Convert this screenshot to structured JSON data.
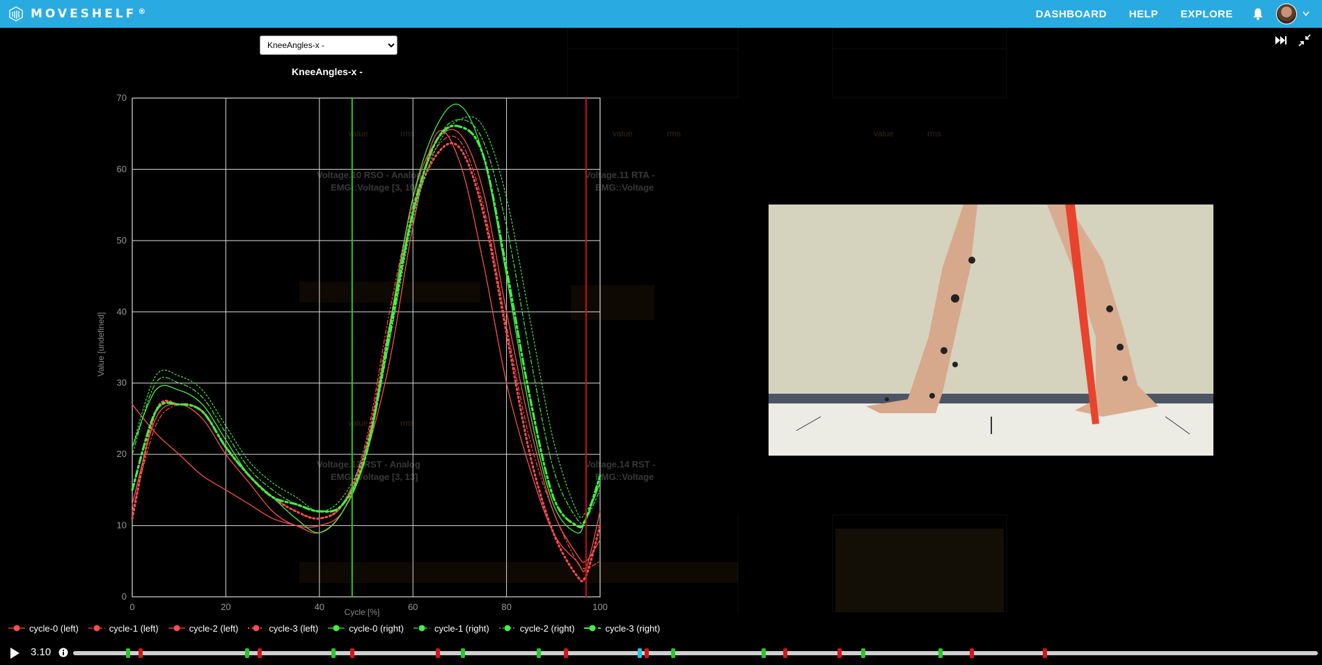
{
  "brand": {
    "name": "MOVESHELF",
    "reg": "®"
  },
  "nav": {
    "dashboard": "DASHBOARD",
    "help": "HELP",
    "explore": "EXPLORE"
  },
  "colors": {
    "topbar": "#29abe2",
    "left": "#ff4d4d",
    "right": "#44ee44",
    "vline_right": "#22cc22",
    "vline_left": "#cc1111",
    "event_cyan": "#22c4e6"
  },
  "plot": {
    "selected": "KneeAngles-x -",
    "options": [
      "KneeAngles-x -"
    ],
    "title": "KneeAngles-x -"
  },
  "chart_data": {
    "type": "line",
    "title": "KneeAngles-x -",
    "xlabel": "Cycle [%]",
    "ylabel": "Value [undefined]",
    "xlim": [
      0,
      100
    ],
    "ylim": [
      0,
      70
    ],
    "xticks": [
      0,
      20,
      40,
      60,
      80,
      100
    ],
    "yticks": [
      0,
      10,
      20,
      30,
      40,
      50,
      60,
      70
    ],
    "grid": true,
    "vlines": [
      {
        "x": 47,
        "color": "#22cc22"
      },
      {
        "x": 97,
        "color": "#cc1111"
      }
    ],
    "series": [
      {
        "name": "cycle-0 (left)",
        "side": "left",
        "style": "thin",
        "x": [
          0,
          5,
          10,
          15,
          20,
          25,
          30,
          35,
          40,
          45,
          50,
          55,
          60,
          65,
          70,
          75,
          80,
          85,
          90,
          95,
          97,
          100
        ],
        "values": [
          27,
          23,
          20,
          17,
          15,
          13,
          11,
          10,
          9,
          12,
          20,
          33,
          52,
          65,
          61,
          47,
          30,
          18,
          9,
          5,
          4,
          12
        ]
      },
      {
        "name": "cycle-1 (left)",
        "side": "left",
        "style": "dashdot-thin",
        "x": [
          0,
          5,
          10,
          15,
          20,
          25,
          30,
          35,
          40,
          45,
          50,
          55,
          60,
          65,
          70,
          75,
          80,
          85,
          90,
          95,
          97,
          100
        ],
        "values": [
          12,
          24,
          27,
          26,
          21,
          17,
          14,
          12,
          11,
          13,
          22,
          40,
          55,
          63,
          64,
          55,
          38,
          22,
          12,
          5,
          4,
          5
        ]
      },
      {
        "name": "cycle-2 (left)",
        "side": "left",
        "style": "thin",
        "x": [
          0,
          5,
          10,
          15,
          20,
          25,
          30,
          35,
          40,
          45,
          50,
          55,
          60,
          65,
          70,
          75,
          80,
          85,
          90,
          95,
          97,
          100
        ],
        "values": [
          13,
          25,
          27,
          25,
          20,
          16,
          12,
          10,
          10,
          12,
          20,
          38,
          56,
          64,
          65,
          57,
          40,
          24,
          12,
          6,
          5,
          8
        ]
      },
      {
        "name": "cycle-3 (left)",
        "side": "left",
        "style": "dotted-thick",
        "x": [
          0,
          5,
          10,
          15,
          20,
          25,
          30,
          35,
          40,
          45,
          50,
          55,
          60,
          65,
          70,
          75,
          80,
          85,
          90,
          95,
          97,
          100
        ],
        "values": [
          11,
          26,
          27,
          26,
          21,
          17,
          14,
          12,
          11,
          13,
          21,
          38,
          54,
          62,
          63,
          54,
          37,
          20,
          9,
          3,
          3,
          10
        ]
      },
      {
        "name": "cycle-0 (right)",
        "side": "right",
        "style": "thin",
        "x": [
          0,
          5,
          10,
          15,
          20,
          25,
          30,
          35,
          40,
          45,
          50,
          55,
          60,
          65,
          70,
          75,
          80,
          85,
          90,
          95,
          97,
          100
        ],
        "values": [
          21,
          29,
          29,
          27,
          22,
          17,
          14,
          11,
          9,
          12,
          20,
          38,
          56,
          66,
          69,
          62,
          45,
          26,
          13,
          9,
          11,
          16
        ]
      },
      {
        "name": "cycle-1 (right)",
        "side": "right",
        "style": "dashdot-thin",
        "x": [
          0,
          5,
          10,
          15,
          20,
          25,
          30,
          35,
          40,
          45,
          50,
          55,
          60,
          65,
          70,
          75,
          80,
          85,
          90,
          95,
          97,
          100
        ],
        "values": [
          20,
          30,
          30,
          28,
          23,
          18,
          15,
          13,
          12,
          13,
          20,
          36,
          54,
          64,
          67,
          64,
          52,
          34,
          18,
          11,
          11,
          15
        ]
      },
      {
        "name": "cycle-2 (right)",
        "side": "right",
        "style": "dotted-thin",
        "x": [
          0,
          5,
          10,
          15,
          20,
          25,
          30,
          35,
          40,
          45,
          50,
          55,
          60,
          65,
          70,
          75,
          80,
          85,
          90,
          95,
          97,
          100
        ],
        "values": [
          21,
          31,
          31,
          29,
          24,
          19,
          16,
          14,
          12,
          14,
          21,
          36,
          53,
          63,
          67,
          66,
          56,
          39,
          22,
          12,
          12,
          16
        ]
      },
      {
        "name": "cycle-3 (right)",
        "side": "right",
        "style": "dashdot-thick",
        "x": [
          0,
          5,
          10,
          15,
          20,
          25,
          30,
          35,
          40,
          45,
          50,
          55,
          60,
          65,
          70,
          75,
          80,
          85,
          90,
          95,
          97,
          100
        ],
        "values": [
          15,
          26,
          27,
          26,
          21,
          17,
          14,
          13,
          12,
          13,
          20,
          37,
          54,
          64,
          66,
          62,
          46,
          28,
          14,
          10,
          11,
          17
        ]
      }
    ]
  },
  "legend": [
    {
      "label": "cycle-0 (left)",
      "side": "left",
      "style": "thin"
    },
    {
      "label": "cycle-1 (left)",
      "side": "left",
      "style": "dashdot-thin"
    },
    {
      "label": "cycle-2 (left)",
      "side": "left",
      "style": "thin"
    },
    {
      "label": "cycle-3 (left)",
      "side": "left",
      "style": "dotted-thick"
    },
    {
      "label": "cycle-0 (right)",
      "side": "right",
      "style": "thin"
    },
    {
      "label": "cycle-1 (right)",
      "side": "right",
      "style": "dashdot-thin"
    },
    {
      "label": "cycle-2 (right)",
      "side": "right",
      "style": "dotted-thin"
    },
    {
      "label": "cycle-3 (right)",
      "side": "right",
      "style": "dashdot-thick"
    }
  ],
  "background_panels": [
    {
      "title": "Voltage.10 RSO - Analog",
      "subtitle": "EMG::Voltage [3, 10]"
    },
    {
      "title": "Voltage.11 RTA -",
      "subtitle": "EMG::Voltage"
    },
    {
      "title": "Voltage.13 RST - Analog",
      "subtitle": "EMG::Voltage [3, 13]"
    },
    {
      "title": "Voltage.14 RST -",
      "subtitle": "EMG::Voltage"
    }
  ],
  "background_legend": {
    "value": "value",
    "rms": "rms"
  },
  "video": {
    "icon": "video-frame"
  },
  "toolbar": {
    "skip_icon": "skip-forward-icon",
    "collapse_icon": "collapse-icon"
  },
  "playback": {
    "time": "3.10",
    "events": [
      {
        "t": 0.044,
        "color": "green"
      },
      {
        "t": 0.054,
        "color": "red"
      },
      {
        "t": 0.14,
        "color": "green"
      },
      {
        "t": 0.15,
        "color": "red"
      },
      {
        "t": 0.209,
        "color": "green"
      },
      {
        "t": 0.224,
        "color": "red"
      },
      {
        "t": 0.293,
        "color": "red"
      },
      {
        "t": 0.313,
        "color": "green"
      },
      {
        "t": 0.374,
        "color": "green"
      },
      {
        "t": 0.396,
        "color": "red"
      },
      {
        "t": 0.455,
        "color": "cyan"
      },
      {
        "t": 0.461,
        "color": "red"
      },
      {
        "t": 0.482,
        "color": "green"
      },
      {
        "t": 0.555,
        "color": "green"
      },
      {
        "t": 0.572,
        "color": "red"
      },
      {
        "t": 0.616,
        "color": "red"
      },
      {
        "t": 0.635,
        "color": "green"
      },
      {
        "t": 0.697,
        "color": "green"
      },
      {
        "t": 0.722,
        "color": "red"
      },
      {
        "t": 0.781,
        "color": "red"
      }
    ]
  }
}
